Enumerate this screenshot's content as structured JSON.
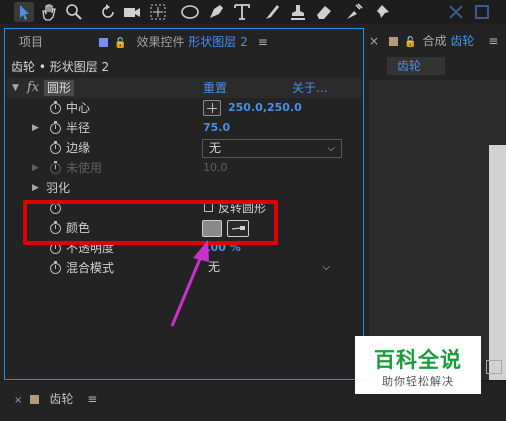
{
  "toolbar": {
    "tools": [
      "selection-tool",
      "hand-tool",
      "zoom-tool",
      "rotate-tool",
      "camera-tool",
      "pan-behind-tool",
      "ellipse-tool",
      "pen-tool",
      "type-tool",
      "brush-tool",
      "clone-stamp-tool",
      "eraser-tool",
      "roto-brush-tool",
      "puppet-tool"
    ]
  },
  "left_panel": {
    "tab_project": "项目",
    "tab_effects": "效果控件",
    "tab_layer": "形状图层 2",
    "menu_icon": "≡",
    "breadcrumb": "齿轮 • 形状图层 2",
    "effect": {
      "fx": "fx",
      "name": "圆形",
      "reset": "重置",
      "about": "关于..."
    },
    "params": {
      "center_label": "中心",
      "center_value": "250.0,250.0",
      "radius_label": "半径",
      "radius_value": "75.0",
      "edge_label": "边缘",
      "edge_value": "无",
      "unused_label": "未使用",
      "unused_value": "10.0",
      "feather_label": "羽化",
      "invert_label": "反转圆形",
      "color_label": "颜色",
      "opacity_label": "不透明度",
      "opacity_value": "100 %",
      "blend_label": "混合模式",
      "blend_value": "无"
    },
    "color_swatch": "#8a8a8a"
  },
  "right_panel": {
    "tab_label": "合成",
    "comp_name": "齿轮",
    "menu_icon": "≡",
    "subtab": "齿轮"
  },
  "timeline": {
    "tab_label": "齿轮",
    "menu_icon": "≡"
  },
  "watermark": {
    "title": "百科全说",
    "subtitle": "助你轻松解决"
  },
  "colors": {
    "accent_blue": "#4a8fe6",
    "highlight_red": "#e00000",
    "arrow_magenta": "#c832c8",
    "watermark_green": "#1a9c3c"
  }
}
